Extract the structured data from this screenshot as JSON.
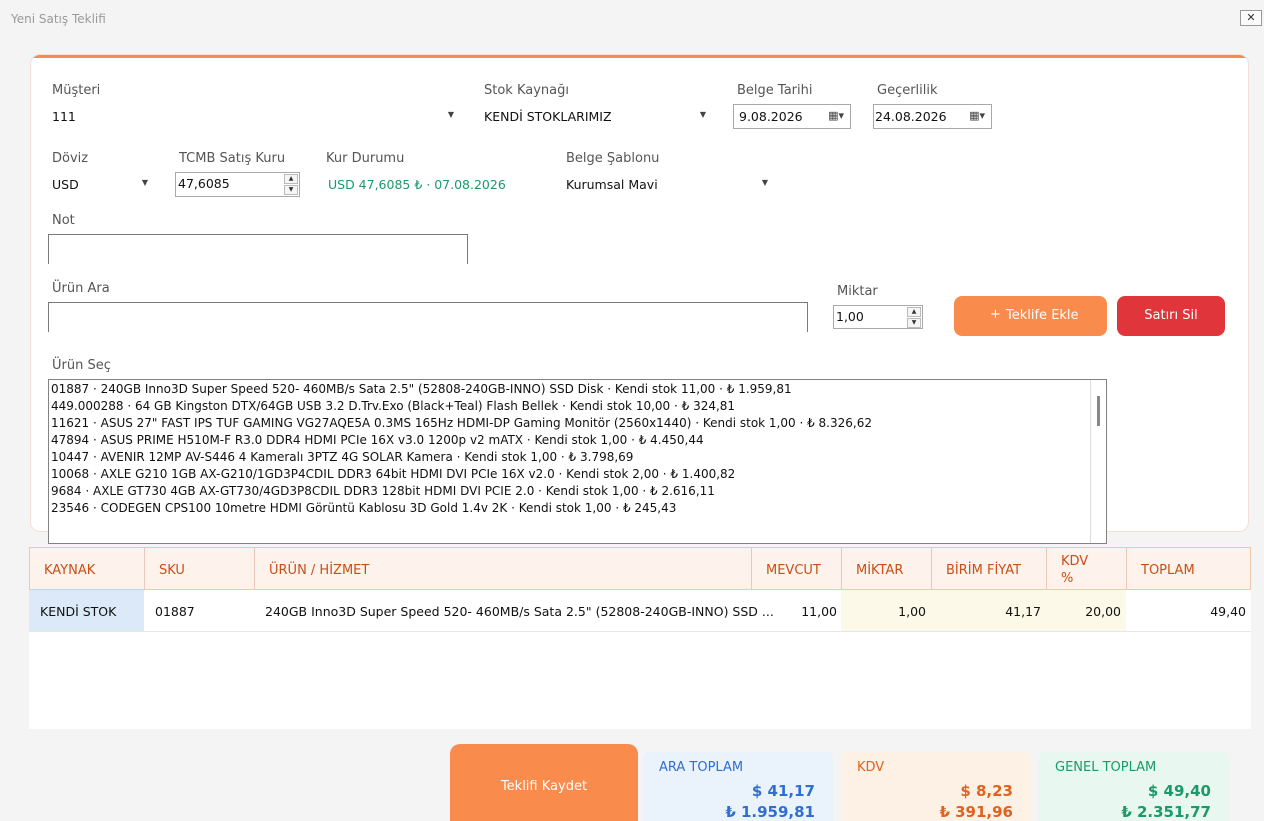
{
  "window": {
    "title": "Yeni Satış Teklifi",
    "close_label": "✕"
  },
  "form": {
    "musteri": {
      "label": "Müşteri",
      "value": "111"
    },
    "stok_kaynagi": {
      "label": "Stok Kaynağı",
      "value": "KENDİ STOKLARIMIZ"
    },
    "belge_tarihi": {
      "label": "Belge Tarihi",
      "value": "9.08.2026"
    },
    "gecerlilik": {
      "label": "Geçerlilik",
      "value": "24.08.2026"
    },
    "doviz": {
      "label": "Döviz",
      "value": "USD"
    },
    "tcmb_kuru": {
      "label": "TCMB Satış Kuru",
      "value": "47,6085"
    },
    "kur_durumu": {
      "label": "Kur Durumu",
      "value": "USD 47,6085 ₺ · 07.08.2026"
    },
    "belge_sablonu": {
      "label": "Belge Şablonu",
      "value": "Kurumsal Mavi"
    },
    "not": {
      "label": "Not",
      "value": ""
    },
    "urun_ara": {
      "label": "Ürün Ara",
      "value": ""
    },
    "miktar": {
      "label": "Miktar",
      "value": "1,00"
    },
    "urun_sec": {
      "label": "Ürün Seç"
    }
  },
  "buttons": {
    "add": "Teklife Ekle",
    "add_icon": "+",
    "delete": "Satırı Sil",
    "save": "Teklifi Kaydet"
  },
  "product_list": [
    "01887 · 240GB Inno3D Super Speed 520- 460MB/s Sata 2.5\" (52808-240GB-INNO) SSD Disk · Kendi stok 11,00 · ₺ 1.959,81",
    "449.000288 · 64 GB Kingston DTX/64GB USB 3.2 D.Trv.Exo (Black+Teal)  Flash Bellek · Kendi stok 10,00 · ₺ 324,81",
    "11621 · ASUS 27\" FAST IPS TUF GAMING VG27AQE5A 0.3MS 165Hz HDMI-DP Gaming Monitör (2560x1440) · Kendi stok 1,00 · ₺ 8.326,62",
    "47894 · ASUS PRIME H510M-F R3.0 DDR4 HDMI PCIe 16X v3.0 1200p v2 mATX · Kendi stok 1,00 · ₺ 4.450,44",
    "10447 · AVENIR 12MP AV-S446 4 Kameralı 3PTZ 4G SOLAR Kamera · Kendi stok 1,00 · ₺ 3.798,69",
    "10068 · AXLE G210 1GB AX-G210/1GD3P4CDIL DDR3 64bit HDMI DVI PCIe 16X v2.0 · Kendi stok 2,00 · ₺ 1.400,82",
    "9684 · AXLE GT730 4GB AX-GT730/4GD3P8CDIL DDR3 128bit HDMI DVI PCIE 2.0 · Kendi stok 1,00 · ₺ 2.616,11",
    "23546 · CODEGEN CPS100 10metre HDMI Görüntü Kablosu 3D Gold 1.4v 2K · Kendi stok 1,00 · ₺ 245,43"
  ],
  "grid": {
    "columns": [
      "KAYNAK",
      "SKU",
      "ÜRÜN / HİZMET",
      "MEVCUT",
      "MİKTAR",
      "BİRİM FİYAT",
      "KDV",
      "%",
      "TOPLAM"
    ],
    "rows": [
      {
        "kaynak": "KENDİ STOK",
        "sku": "01887",
        "urun": "240GB Inno3D Super Speed 520- 460MB/s Sata 2.5\" (52808-240GB-INNO) SSD ...",
        "mevcut": "11,00",
        "miktar": "1,00",
        "birim_fiyat": "41,17",
        "kdv": "20,00",
        "toplam": "49,40"
      }
    ]
  },
  "totals": {
    "ara_toplam": {
      "label": "ARA TOPLAM",
      "usd": "$ 41,17",
      "try": "₺ 1.959,81"
    },
    "kdv": {
      "label": "KDV",
      "usd": "$ 8,23",
      "try": "₺ 391,96"
    },
    "genel_toplam": {
      "label": "GENEL TOPLAM",
      "usd": "$ 49,40",
      "try": "₺ 2.351,77"
    }
  },
  "colors": {
    "accent": "#f58a4b",
    "danger": "#e0353a",
    "blue": "#2f6fd1",
    "orange": "#e0631c",
    "green": "#1a9a6a"
  }
}
